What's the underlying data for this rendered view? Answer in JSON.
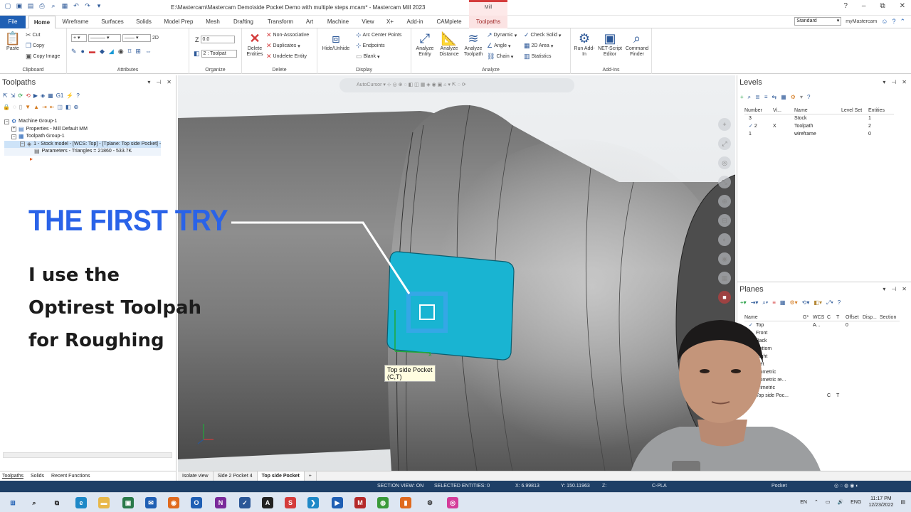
{
  "titlebar": {
    "title": "E:\\Mastercam\\Mastercam Demo\\side Pocket Demo with multiple steps.mcam* - Mastercam Mill 2023",
    "context_tab": "Mill"
  },
  "tabs": [
    "File",
    "Home",
    "Wireframe",
    "Surfaces",
    "Solids",
    "Model Prep",
    "Mesh",
    "Drafting",
    "Transform",
    "Art",
    "Machine",
    "View",
    "X+",
    "Add-in",
    "CAMplete",
    "Toolpaths"
  ],
  "active_tab": "Home",
  "tabrow_right": {
    "standard": "Standard",
    "my_mastercam": "myMastercam"
  },
  "ribbon": {
    "clipboard": {
      "label": "Clipboard",
      "paste": "Paste",
      "cut": "Cut",
      "copy": "Copy",
      "copy_image": "Copy Image"
    },
    "attributes": {
      "label": "Attributes",
      "dim": "2D"
    },
    "organize": {
      "label": "Organize",
      "z_label": "Z",
      "z_value": "0.0",
      "level_value": "2 : Toolpat"
    },
    "delete": {
      "label": "Delete",
      "delete_entities": "Delete Entities",
      "non_associative": "Non-Associative",
      "duplicates": "Duplicates",
      "undelete_entity": "Undelete Entity"
    },
    "display": {
      "label": "Display",
      "hide_unhide": "Hide/Unhide",
      "arc_center_points": "Arc Center Points",
      "endpoints": "Endpoints",
      "blank": "Blank"
    },
    "analyze": {
      "label": "Analyze",
      "analyze_entity": "Analyze Entity",
      "analyze_distance": "Analyze Distance",
      "analyze_toolpath": "Analyze Toolpath",
      "dynamic": "Dynamic",
      "angle": "Angle",
      "chain": "Chain",
      "check_solid": "Check Solid",
      "area_2d": "2D Area",
      "statistics": "Statistics"
    },
    "addins": {
      "label": "Add-Ins",
      "run_addin": "Run Add-In",
      "net_script_editor": "NET-Script Editor",
      "command_finder": "Command Finder"
    }
  },
  "toolpaths_panel": {
    "title": "Toolpaths",
    "tree": [
      "Machine Group-1",
      "Properties - Mill Default MM",
      "Toolpath Group-1",
      "1 - Stock model - [WCS: Top] - [Tplane: Top side Pocket] -",
      "Parameters - Triangles =  21860 - 533.7K"
    ],
    "bottom_tabs": [
      "Toolpaths",
      "Solids",
      "Recent Functions"
    ]
  },
  "viewport": {
    "autocursor": "AutoCursor",
    "tooltip_line1": "Top side Pocket",
    "tooltip_line2": "(C,T)"
  },
  "overlay": {
    "title": "THE FIRST TRY",
    "line1": "I use the",
    "line2": "Optirest Toolpah",
    "line3": "for Roughing"
  },
  "levels_panel": {
    "title": "Levels",
    "headers": [
      "Number",
      "Vi...",
      "Name",
      "Level Set",
      "Entities"
    ],
    "rows": [
      {
        "check": "",
        "number": "3",
        "visible": "",
        "name": "Stock",
        "set": "",
        "entities": "1"
      },
      {
        "check": "✓",
        "number": "2",
        "visible": "X",
        "name": "Toolpath",
        "set": "",
        "entities": "2"
      },
      {
        "check": "",
        "number": "1",
        "visible": "",
        "name": "wireframe",
        "set": "",
        "entities": "0"
      }
    ]
  },
  "planes_panel": {
    "title": "Planes",
    "headers": [
      "Name",
      "G*",
      "WCS",
      "C",
      "T",
      "Offset",
      "Disp...",
      "Section"
    ],
    "rows": [
      {
        "check": "✓",
        "name": "Top",
        "wcs": "A...",
        "c": "",
        "t": "",
        "offset": "0"
      },
      {
        "check": "",
        "name": "Front",
        "wcs": "",
        "c": "",
        "t": "",
        "offset": ""
      },
      {
        "check": "",
        "name": "Back",
        "wcs": "",
        "c": "",
        "t": "",
        "offset": ""
      },
      {
        "check": "",
        "name": "Bottom",
        "wcs": "",
        "c": "",
        "t": "",
        "offset": ""
      },
      {
        "check": "",
        "name": "Right",
        "wcs": "",
        "c": "",
        "t": "",
        "offset": ""
      },
      {
        "check": "",
        "name": "Left",
        "wcs": "",
        "c": "",
        "t": "",
        "offset": ""
      },
      {
        "check": "",
        "name": "Isometric",
        "wcs": "",
        "c": "",
        "t": "",
        "offset": ""
      },
      {
        "check": "",
        "name": "Isometric re...",
        "wcs": "",
        "c": "",
        "t": "",
        "offset": ""
      },
      {
        "check": "",
        "name": "Trimetric",
        "wcs": "",
        "c": "",
        "t": "",
        "offset": ""
      },
      {
        "check": "",
        "name": "Top side Poc...",
        "wcs": "",
        "c": "C",
        "t": "T",
        "offset": ""
      }
    ]
  },
  "sheet_tabs": [
    "Isolate view",
    "Side 2 Pocket 4",
    "Top side Pocket",
    "+"
  ],
  "statusbar": {
    "section_view": "SECTION VIEW: ON",
    "selected": "SELECTED ENTITIES: 0",
    "x": "X:  6.99813",
    "y": "Y:  150.11963",
    "z": "Z:",
    "cplane": "C-PLA",
    "pocket": "Pocket"
  },
  "taskbar": {
    "lang1": "EN",
    "lang2": "ENG",
    "time": "11:17 PM",
    "date": "12/23/2022"
  },
  "colors": {
    "file_tab": "#1f5fb4",
    "overlay_title": "#2a63e8",
    "pocket_face": "#19b4d2",
    "status_bar": "#1e3f66"
  }
}
